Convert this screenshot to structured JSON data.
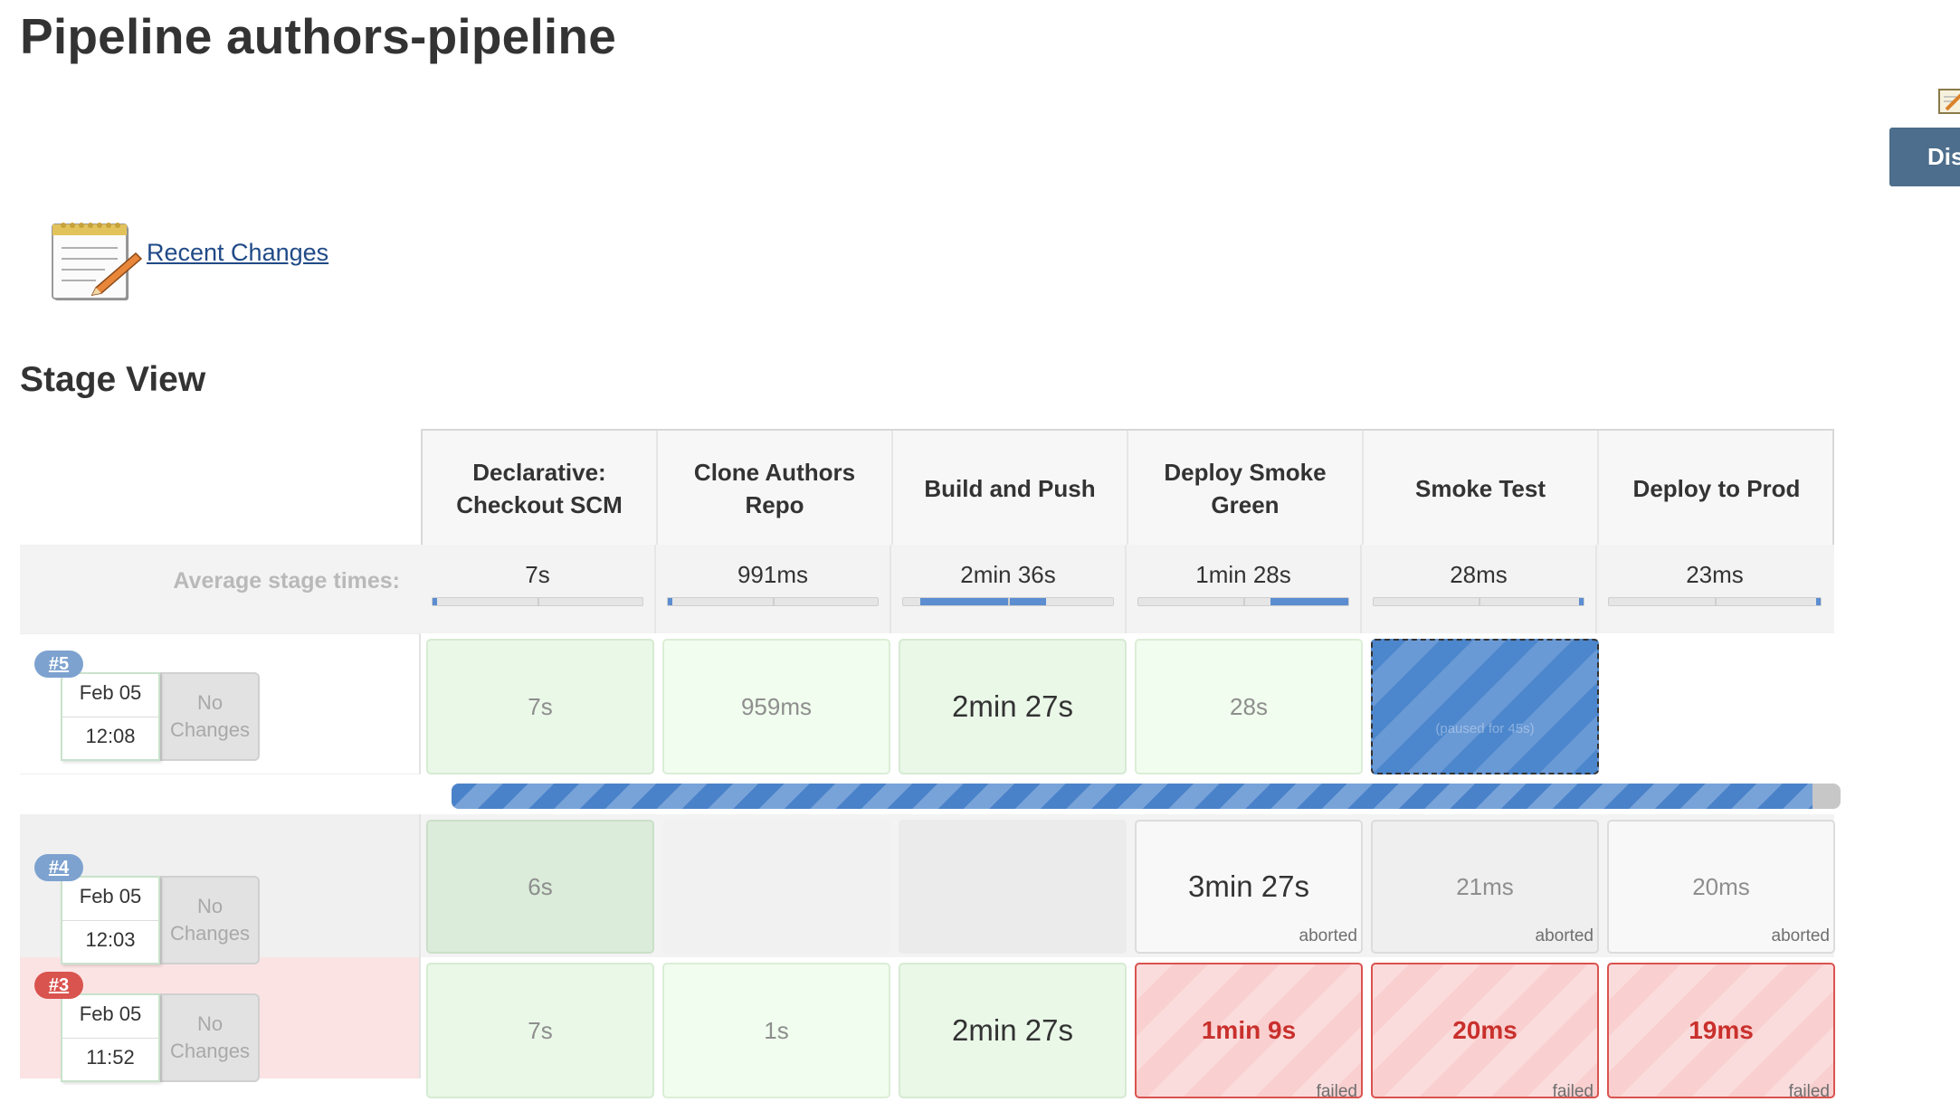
{
  "page": {
    "title": "Pipeline authors-pipeline",
    "side_button_label": "Dis"
  },
  "recent_changes": {
    "label": "Recent Changes",
    "icon": "notepad-icon"
  },
  "stage_view": {
    "title": "Stage View",
    "avg_label": "Average stage times:",
    "stages": [
      {
        "name": "Declarative: Checkout SCM",
        "avg": "7s",
        "avg_fill": 0.01
      },
      {
        "name": "Clone Authors Repo",
        "avg": "991ms",
        "avg_fill": 0.01
      },
      {
        "name": "Build and Push",
        "avg": "2min 36s",
        "avg_fill": 0.6
      },
      {
        "name": "Deploy Smoke Green",
        "avg": "1min 28s",
        "avg_fill": 0.37
      },
      {
        "name": "Smoke Test",
        "avg": "28ms",
        "avg_fill": 0.01
      },
      {
        "name": "Deploy to Prod",
        "avg": "23ms",
        "avg_fill": 0.01
      }
    ],
    "runs": [
      {
        "id": "#5",
        "date": "Feb 05",
        "time": "12:08",
        "changes": "No Changes",
        "cells": [
          {
            "value": "7s",
            "status": ""
          },
          {
            "value": "959ms",
            "status": ""
          },
          {
            "value": "2min 27s",
            "status": ""
          },
          {
            "value": "28s",
            "status": ""
          },
          {
            "value": "",
            "status": "(paused for 45s)"
          },
          {
            "value": "",
            "status": ""
          }
        ],
        "progress": 0.98
      },
      {
        "id": "#4",
        "date": "Feb 05",
        "time": "12:03",
        "changes": "No Changes",
        "cells": [
          {
            "value": "6s",
            "status": ""
          },
          {
            "value": "",
            "status": ""
          },
          {
            "value": "",
            "status": ""
          },
          {
            "value": "3min 27s",
            "status": "aborted"
          },
          {
            "value": "21ms",
            "status": "aborted"
          },
          {
            "value": "20ms",
            "status": "aborted"
          }
        ]
      },
      {
        "id": "#3",
        "date": "Feb 05",
        "time": "11:52",
        "changes": "No Changes",
        "cells": [
          {
            "value": "7s",
            "status": ""
          },
          {
            "value": "1s",
            "status": ""
          },
          {
            "value": "2min 27s",
            "status": ""
          },
          {
            "value": "1min 9s",
            "status": "failed"
          },
          {
            "value": "20ms",
            "status": "failed"
          },
          {
            "value": "19ms",
            "status": "failed"
          }
        ]
      }
    ]
  },
  "colors": {
    "success": "#eaf8e8",
    "failed_border": "#d9534f",
    "paused": "#4c86cc",
    "badge_running": "#7da2cf",
    "badge_failed": "#d9534f"
  }
}
